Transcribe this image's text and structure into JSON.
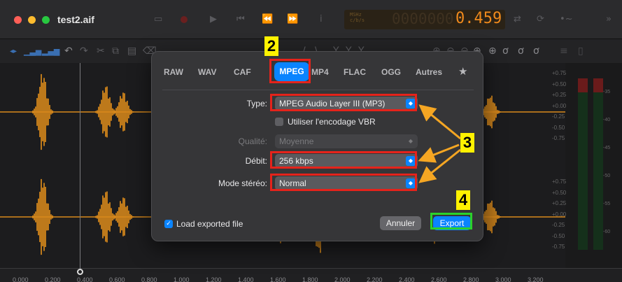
{
  "window": {
    "title": "test2.aif"
  },
  "lcd": {
    "unit_top": "MSHz",
    "unit_bottom": "c/b/s",
    "ghost_digits": "0000000",
    "value": "0.459"
  },
  "dialog": {
    "tabs": [
      {
        "label": "RAW"
      },
      {
        "label": "WAV"
      },
      {
        "label": "CAF"
      },
      {
        "label": "MPEG",
        "active": true
      },
      {
        "label": "MP4"
      },
      {
        "label": "FLAC"
      },
      {
        "label": "OGG"
      },
      {
        "label": "Autres"
      }
    ],
    "favorite_icon": "star-icon",
    "type": {
      "label": "Type:",
      "value": "MPEG Audio Layer III (MP3)"
    },
    "vbr": {
      "label": "Utiliser l'encodage VBR",
      "checked": false
    },
    "quality": {
      "label": "Qualité:",
      "value": "Moyenne",
      "disabled": true
    },
    "bitrate": {
      "label": "Débit:",
      "value": "256 kbps"
    },
    "stereo_mode": {
      "label": "Mode stéréo:",
      "value": "Normal"
    },
    "load_exported": {
      "label": "Load exported file",
      "checked": true
    },
    "cancel_label": "Annuler",
    "export_label": "Export"
  },
  "annotations": {
    "step2": "2",
    "step3": "3",
    "step4": "4"
  },
  "db_scale": {
    "upper": [
      "+0.75",
      "+0.50",
      "+0.25",
      "+0.00",
      "-0.25",
      "-0.50",
      "-0.75"
    ],
    "lower": [
      "+0.75",
      "+0.50",
      "+0.25",
      "+0.00",
      "-0.25",
      "-0.50",
      "-0.75"
    ]
  },
  "ruler": {
    "labels": [
      "0.000",
      "0.200",
      "0.400",
      "0.600",
      "0.800",
      "1.000",
      "1.200",
      "1.400",
      "1.600",
      "1.800",
      "2.000",
      "2.200",
      "2.400",
      "2.600",
      "2.800",
      "3.000",
      "3.200"
    ]
  },
  "meter": {
    "labels": [
      "-35",
      "-40",
      "-45",
      "-50",
      "-55",
      "-60"
    ]
  },
  "colors": {
    "waveform": "#d9891b",
    "accent": "#0a84ff",
    "highlight": "#e5231b",
    "export_highlight": "#2bd22b",
    "badge": "#fff200",
    "arrow": "#f5a623"
  }
}
